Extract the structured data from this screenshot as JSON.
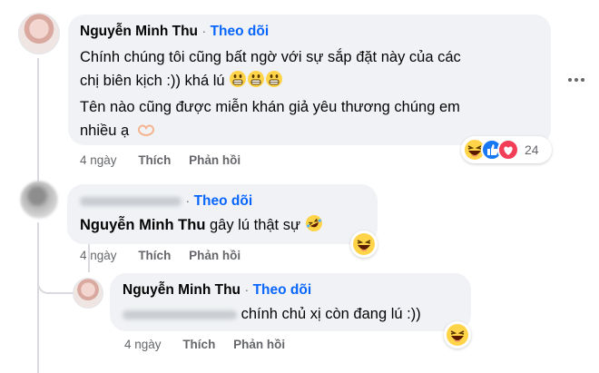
{
  "comment1": {
    "author": "Nguyễn Minh Thu",
    "separator": "·",
    "follow_label": "Theo dõi",
    "line1": "Chính chúng tôi cũng bất ngờ với sự sắp đặt này của các",
    "line2": "chị biên kịch :)) khá lú",
    "line3": "Tên nào cũng được miễn khán giả yêu thương chúng em",
    "line4": "nhiều ạ",
    "time": "4 ngày",
    "like_label": "Thích",
    "reply_label": "Phản hồi",
    "reaction_count": "24",
    "more_icon": "more-horizontal-icon"
  },
  "comment2": {
    "separator": "·",
    "follow_label": "Theo dõi",
    "mention": "Nguyễn Minh Thu",
    "text": "gây lú thật sự",
    "time": "4 ngày",
    "like_label": "Thích",
    "reply_label": "Phản hồi"
  },
  "comment3": {
    "author": "Nguyễn Minh Thu",
    "separator": "·",
    "follow_label": "Theo dõi",
    "text": "chính chủ xị còn đang lú :))",
    "time": "4 ngày",
    "like_label": "Thích",
    "reply_label": "Phản hồi"
  },
  "colors": {
    "follow": "#0866ff",
    "bubble": "#f0f2f5",
    "meta": "#65676b",
    "like_reaction": "#1877f2",
    "love_reaction": "#f33e58",
    "haha_reaction": "#ffd449"
  }
}
